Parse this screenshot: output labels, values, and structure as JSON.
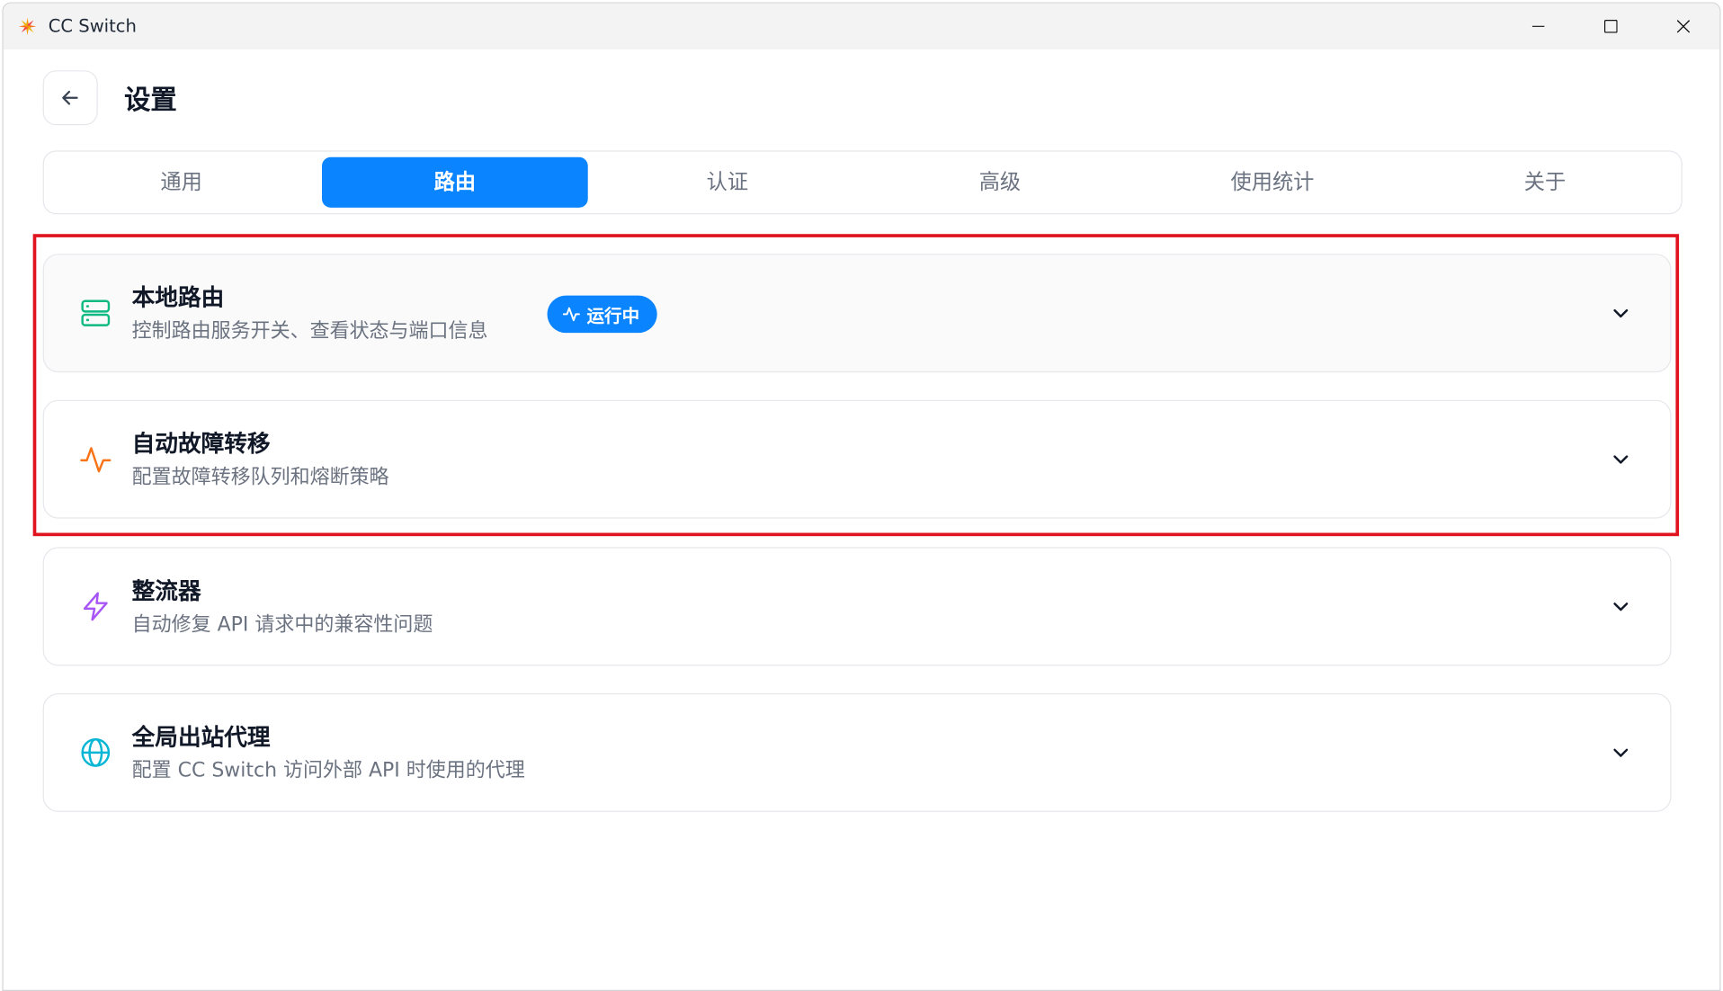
{
  "window": {
    "title": "CC Switch"
  },
  "header": {
    "title": "设置"
  },
  "tabs": [
    {
      "label": "通用",
      "active": false
    },
    {
      "label": "路由",
      "active": true
    },
    {
      "label": "认证",
      "active": false
    },
    {
      "label": "高级",
      "active": false
    },
    {
      "label": "使用统计",
      "active": false
    },
    {
      "label": "关于",
      "active": false
    }
  ],
  "sections": [
    {
      "title": "本地路由",
      "description": "控制路由服务开关、查看状态与端口信息",
      "icon": "server-icon",
      "icon_color": "#10b981",
      "badge": "运行中"
    },
    {
      "title": "自动故障转移",
      "description": "配置故障转移队列和熔断策略",
      "icon": "activity-icon",
      "icon_color": "#f97316"
    },
    {
      "title": "整流器",
      "description": "自动修复 API 请求中的兼容性问题",
      "icon": "lightning-icon",
      "icon_color": "#a855f7"
    },
    {
      "title": "全局出站代理",
      "description": "配置 CC Switch 访问外部 API 时使用的代理",
      "icon": "globe-icon",
      "icon_color": "#06b6d4"
    }
  ],
  "colors": {
    "accent": "#0a84ff",
    "highlight_border": "#e0141e"
  }
}
